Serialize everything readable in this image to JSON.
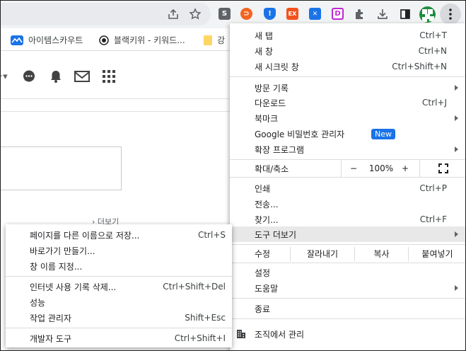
{
  "toolbar": {
    "extensions": [
      {
        "name": "ext-s",
        "glyph": "S",
        "color": "#5f6368"
      },
      {
        "name": "ext-rss",
        "glyph": "⊃",
        "color": "#f26522"
      },
      {
        "name": "ext-shield",
        "glyph": "!",
        "color": "#1a73e8"
      },
      {
        "name": "ext-ex",
        "glyph": "EX",
        "color": "#f4511e"
      },
      {
        "name": "ext-x",
        "glyph": "✕",
        "color": "#1a73e8"
      },
      {
        "name": "ext-d",
        "glyph": "D",
        "color": "#c026d3"
      }
    ]
  },
  "bookmarks": [
    {
      "label": "아이템스카우트"
    },
    {
      "label": "블랙키위 - 키워드..."
    },
    {
      "label": "강"
    }
  ],
  "page": {
    "more_label": "› 더보기"
  },
  "menu": {
    "new_tab": {
      "label": "새 탭",
      "shortcut": "Ctrl+T"
    },
    "new_window": {
      "label": "새 창",
      "shortcut": "Ctrl+N"
    },
    "incognito": {
      "label": "새 시크릿 창",
      "shortcut": "Ctrl+Shift+N"
    },
    "history": {
      "label": "방문 기록"
    },
    "downloads": {
      "label": "다운로드",
      "shortcut": "Ctrl+J"
    },
    "bookmarks": {
      "label": "북마크"
    },
    "passwords": {
      "label": "Google 비밀번호 관리자",
      "badge": "New"
    },
    "extensions": {
      "label": "확장 프로그램"
    },
    "zoom": {
      "label": "확대/축소",
      "minus": "−",
      "value": "100%",
      "plus": "+"
    },
    "print": {
      "label": "인쇄",
      "shortcut": "Ctrl+P"
    },
    "cast": {
      "label": "전송..."
    },
    "find": {
      "label": "찾기...",
      "shortcut": "Ctrl+F"
    },
    "more_tools": {
      "label": "도구 더보기"
    },
    "edit": {
      "label": "수정",
      "cut": "잘라내기",
      "copy": "복사",
      "paste": "붙여넣기"
    },
    "settings": {
      "label": "설정"
    },
    "help": {
      "label": "도움말"
    },
    "exit": {
      "label": "종료"
    },
    "managed": {
      "label": "조직에서 관리"
    }
  },
  "submenu": {
    "save_page": {
      "label": "페이지를 다른 이름으로 저장...",
      "shortcut": "Ctrl+S"
    },
    "create_shortcut": {
      "label": "바로가기 만들기..."
    },
    "name_window": {
      "label": "창 이름 지정..."
    },
    "clear_data": {
      "label": "인터넷 사용 기록 삭제...",
      "shortcut": "Ctrl+Shift+Del"
    },
    "performance": {
      "label": "성능"
    },
    "task_manager": {
      "label": "작업 관리자",
      "shortcut": "Shift+Esc"
    },
    "dev_tools": {
      "label": "개발자 도구",
      "shortcut": "Ctrl+Shift+I"
    }
  }
}
